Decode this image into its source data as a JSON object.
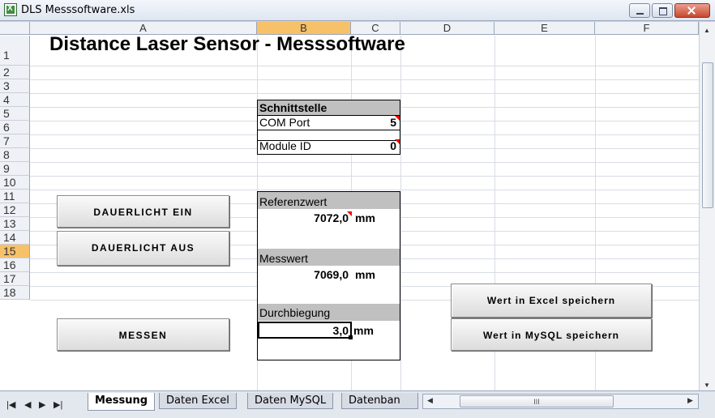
{
  "window": {
    "title": "DLS Messsoftware.xls"
  },
  "columns": [
    "A",
    "B",
    "C",
    "D",
    "E",
    "F"
  ],
  "rows": [
    "1",
    "2",
    "3",
    "4",
    "5",
    "6",
    "7",
    "8",
    "9",
    "10",
    "11",
    "12",
    "13",
    "14",
    "15",
    "16",
    "17",
    "18"
  ],
  "selected": {
    "column": "B",
    "row": "15"
  },
  "sheet": {
    "title": "Distance Laser Sensor - Messsoftware",
    "interface_header": "Schnittstelle",
    "com_port_label": "COM Port",
    "com_port_value": "5",
    "module_id_label": "Module ID",
    "module_id_value": "0",
    "reference_label": "Referenzwert",
    "reference_value": "7072,0",
    "measured_label": "Messwert",
    "measured_value": "7069,0",
    "deflection_label": "Durchbiegung",
    "deflection_value": "3,0",
    "unit": "mm"
  },
  "buttons": {
    "light_on": "DAUERLICHT EIN",
    "light_off": "DAUERLICHT AUS",
    "measure": "MESSEN",
    "save_excel": "Wert in Excel speichern",
    "save_mysql": "Wert in MySQL speichern"
  },
  "tabs": [
    "Messung",
    "Daten Excel",
    "Daten MySQL",
    "Datenban"
  ],
  "active_tab": "Messung",
  "hscroll_grip": "III"
}
